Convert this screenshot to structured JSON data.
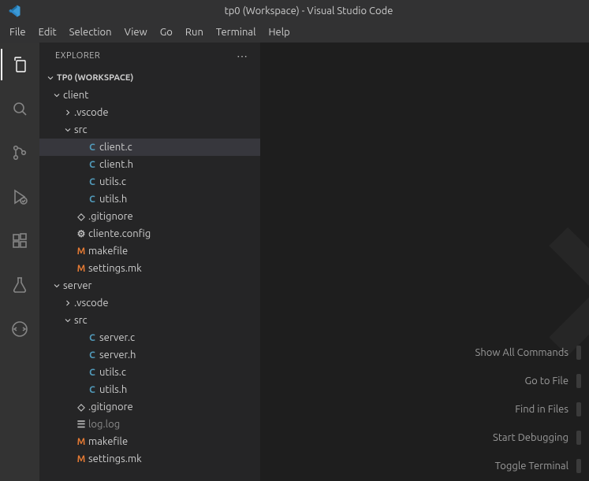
{
  "title": "tp0 (Workspace) - Visual Studio Code",
  "menubar": [
    "File",
    "Edit",
    "Selection",
    "View",
    "Go",
    "Run",
    "Terminal",
    "Help"
  ],
  "sidebar": {
    "header": "EXPLORER",
    "workspace": "TP0 (WORKSPACE)"
  },
  "tree": [
    {
      "type": "folder",
      "name": "client",
      "depth": 0,
      "expanded": true
    },
    {
      "type": "folder",
      "name": ".vscode",
      "depth": 1,
      "expanded": false
    },
    {
      "type": "folder",
      "name": "src",
      "depth": 1,
      "expanded": true
    },
    {
      "type": "file",
      "name": "client.c",
      "depth": 2,
      "icon": "c",
      "selected": true
    },
    {
      "type": "file",
      "name": "client.h",
      "depth": 2,
      "icon": "c"
    },
    {
      "type": "file",
      "name": "utils.c",
      "depth": 2,
      "icon": "c"
    },
    {
      "type": "file",
      "name": "utils.h",
      "depth": 2,
      "icon": "c"
    },
    {
      "type": "file",
      "name": ".gitignore",
      "depth": 1,
      "icon": "git"
    },
    {
      "type": "file",
      "name": "cliente.config",
      "depth": 1,
      "icon": "cfg"
    },
    {
      "type": "file",
      "name": "makefile",
      "depth": 1,
      "icon": "m"
    },
    {
      "type": "file",
      "name": "settings.mk",
      "depth": 1,
      "icon": "m"
    },
    {
      "type": "folder",
      "name": "server",
      "depth": 0,
      "expanded": true
    },
    {
      "type": "folder",
      "name": ".vscode",
      "depth": 1,
      "expanded": false
    },
    {
      "type": "folder",
      "name": "src",
      "depth": 1,
      "expanded": true
    },
    {
      "type": "file",
      "name": "server.c",
      "depth": 2,
      "icon": "c"
    },
    {
      "type": "file",
      "name": "server.h",
      "depth": 2,
      "icon": "c"
    },
    {
      "type": "file",
      "name": "utils.c",
      "depth": 2,
      "icon": "c"
    },
    {
      "type": "file",
      "name": "utils.h",
      "depth": 2,
      "icon": "c"
    },
    {
      "type": "file",
      "name": ".gitignore",
      "depth": 1,
      "icon": "git"
    },
    {
      "type": "file",
      "name": "log.log",
      "depth": 1,
      "icon": "log",
      "dim": true
    },
    {
      "type": "file",
      "name": "makefile",
      "depth": 1,
      "icon": "m"
    },
    {
      "type": "file",
      "name": "settings.mk",
      "depth": 1,
      "icon": "m"
    }
  ],
  "commands": [
    "Show All Commands",
    "Go to File",
    "Find in Files",
    "Start Debugging",
    "Toggle Terminal"
  ]
}
